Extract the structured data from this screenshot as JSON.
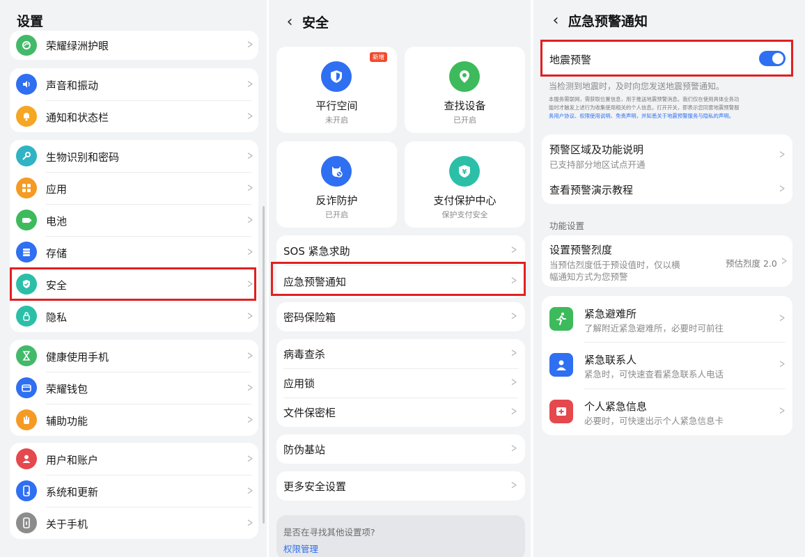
{
  "settings": {
    "title": "设置",
    "items": [
      {
        "label": "荣耀绿洲护眼",
        "icon": "eye-leaf-icon",
        "color": "#43b96a"
      },
      {
        "label": "声音和振动",
        "icon": "speaker-icon",
        "color": "#2f6ff1"
      },
      {
        "label": "通知和状态栏",
        "icon": "bell-icon",
        "color": "#f5a623"
      },
      {
        "label": "生物识别和密码",
        "icon": "key-icon",
        "color": "#30b3c3"
      },
      {
        "label": "应用",
        "icon": "apps-grid-icon",
        "color": "#f59a23"
      },
      {
        "label": "电池",
        "icon": "battery-icon",
        "color": "#3dbb5c"
      },
      {
        "label": "存储",
        "icon": "storage-icon",
        "color": "#2f6ff1"
      },
      {
        "label": "安全",
        "icon": "shield-check-icon",
        "color": "#2bbfa8"
      },
      {
        "label": "隐私",
        "icon": "privacy-lock-icon",
        "color": "#2bbfa8"
      },
      {
        "label": "健康使用手机",
        "icon": "hourglass-icon",
        "color": "#43b96a"
      },
      {
        "label": "荣耀钱包",
        "icon": "wallet-icon",
        "color": "#2f6ff1"
      },
      {
        "label": "辅助功能",
        "icon": "hand-icon",
        "color": "#f59a23"
      },
      {
        "label": "用户和账户",
        "icon": "user-icon",
        "color": "#e5484d"
      },
      {
        "label": "系统和更新",
        "icon": "phone-update-icon",
        "color": "#2f6ff1"
      },
      {
        "label": "关于手机",
        "icon": "phone-info-icon",
        "color": "#8c8c8c"
      }
    ]
  },
  "security": {
    "title": "安全",
    "tiles": [
      {
        "title": "平行空间",
        "sub": "未开启",
        "icon": "parallel-space-icon",
        "color": "#2f6ff1",
        "badge": "新增"
      },
      {
        "title": "查找设备",
        "sub": "已开启",
        "icon": "location-pin-icon",
        "color": "#3dbb5c"
      },
      {
        "title": "反诈防护",
        "sub": "已开启",
        "icon": "anti-fraud-icon",
        "color": "#2f6ff1"
      },
      {
        "title": "支付保护中心",
        "sub": "保护支付安全",
        "icon": "payment-shield-icon",
        "color": "#2bbfa8"
      }
    ],
    "rows": [
      "SOS 紧急求助",
      "应急预警通知",
      "密码保险箱",
      "病毒查杀",
      "应用锁",
      "文件保密柜",
      "防伪基站",
      "更多安全设置"
    ],
    "footer_question": "是否在寻找其他设置项?",
    "footer_link": "权限管理",
    "link_color": "#2f6ff1"
  },
  "emergency": {
    "title": "应急预警通知",
    "quake_label": "地震预警",
    "quake_on": true,
    "quake_desc": "当检测到地震时，及时向您发送地震预警通知。",
    "legal_1": "本服务需联网，需获取位置信息，用于推送地震预警消息。我们仅在使用具体业务功",
    "legal_2": "能时才触发上述行为收集使用相关的个人信息。打开开关，即表示您同意地震预警服",
    "legal_3": "务用户协议、权限使用说明、免责声明，并知悉关于地震预警服务与隐私的声明。",
    "region_title": "预警区域及功能说明",
    "region_sub": "已支持部分地区试点开通",
    "tutorial": "查看预警演示教程",
    "section_label": "功能设置",
    "intensity_title": "设置预警烈度",
    "intensity_sub_1": "当预估烈度低于预设值时，仅以横",
    "intensity_sub_2": "幅通知方式为您预警",
    "intensity_value": "预估烈度 2.0",
    "services": [
      {
        "title": "紧急避难所",
        "sub": "了解附近紧急避难所，必要时可前往",
        "icon": "running-person-icon",
        "color": "#3dbb5c"
      },
      {
        "title": "紧急联系人",
        "sub": "紧急时，可快速查看紧急联系人电话",
        "icon": "contact-person-icon",
        "color": "#2f6ff1"
      },
      {
        "title": "个人紧急信息",
        "sub": "必要时，可快速出示个人紧急信息卡",
        "icon": "medical-cross-icon",
        "color": "#e5484d"
      }
    ]
  }
}
